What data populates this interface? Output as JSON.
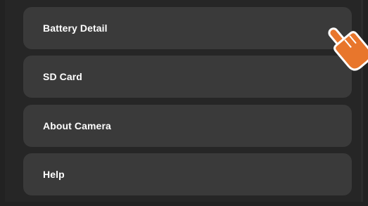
{
  "menu": {
    "items": [
      {
        "label": "Battery Detail"
      },
      {
        "label": "SD Card"
      },
      {
        "label": "About Camera"
      },
      {
        "label": "Help"
      }
    ]
  },
  "colors": {
    "background": "#222222",
    "panel": "#262626",
    "item": "#3a3a3a",
    "text": "#ffffff",
    "pointer_hand": "#e8762c"
  },
  "icons": {
    "pointer": "pointing-hand-icon"
  }
}
